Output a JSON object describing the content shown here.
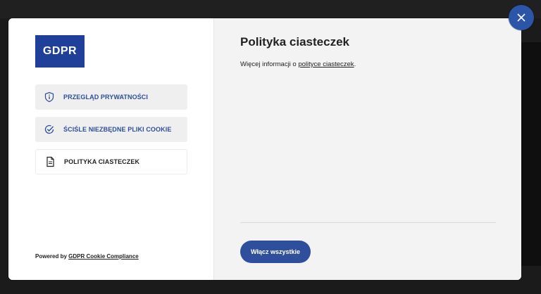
{
  "logo": {
    "text": "GDPR"
  },
  "nav": {
    "items": [
      {
        "label": "PRZEGLĄD PRYWATNOŚCI",
        "icon": "shield-info-icon"
      },
      {
        "label": "ŚCIŚLE NIEZBĘDNE PLIKI COOKIE",
        "icon": "check-circle-icon"
      },
      {
        "label": "POLITYKA CIASTECZEK",
        "icon": "document-icon",
        "active": true
      }
    ]
  },
  "footer": {
    "powered_prefix": "Powered by",
    "powered_link": "GDPR Cookie Compliance"
  },
  "content": {
    "title": "Polityka ciasteczek",
    "desc_prefix": "Więcej informacji o",
    "desc_link": "polityce ciasteczek",
    "desc_suffix": "."
  },
  "actions": {
    "enable_all": "Włącz wszystkie"
  },
  "colors": {
    "accent": "#2f4f9c",
    "logo_bg": "#1f3f99",
    "close_bg": "#2d55a7"
  }
}
